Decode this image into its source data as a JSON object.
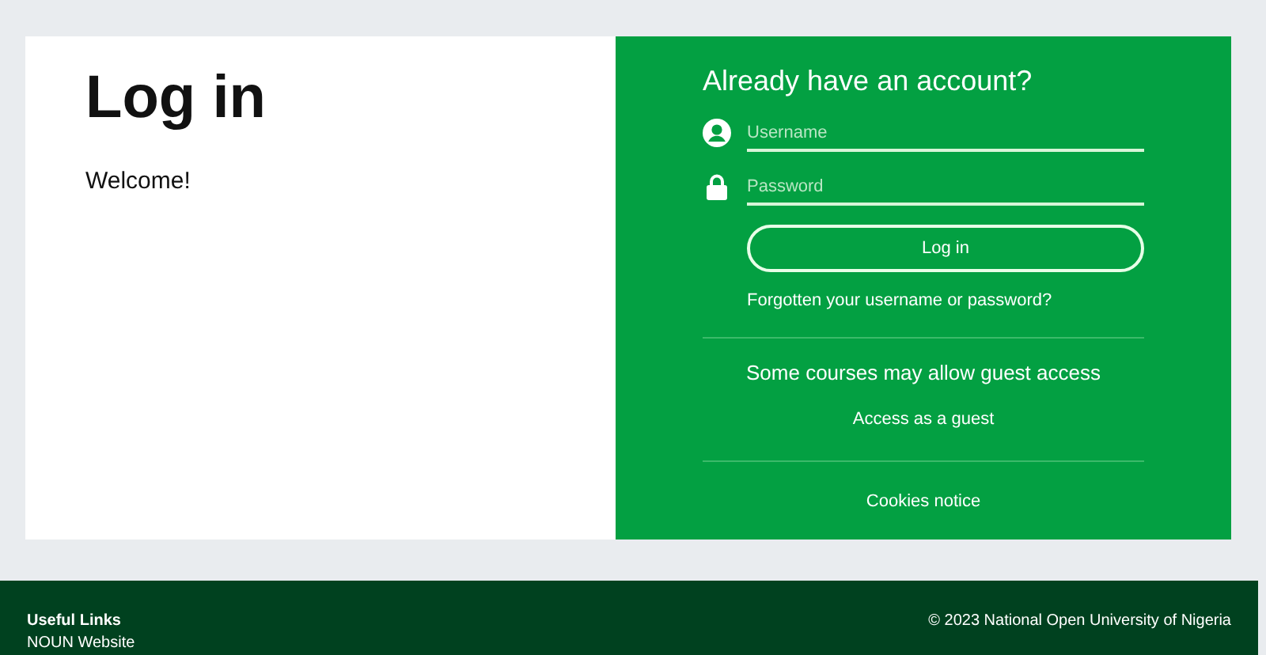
{
  "left_panel": {
    "title": "Log in",
    "welcome": "Welcome!"
  },
  "login_form": {
    "heading": "Already have an account?",
    "fields": [
      {
        "kind": "user",
        "placeholder": "Username"
      },
      {
        "kind": "password",
        "placeholder": "Password"
      }
    ],
    "submit_button": "Log in",
    "forgot_link": "Forgotten your username or password?"
  },
  "guest": {
    "heading": "Some courses may allow guest access",
    "button": "Access as a guest"
  },
  "cookies_link": "Cookies notice",
  "footer": {
    "heading": "Useful Links",
    "links": [
      "NOUN Website"
    ],
    "copyright": "© 2023 National Open University of Nigeria"
  }
}
